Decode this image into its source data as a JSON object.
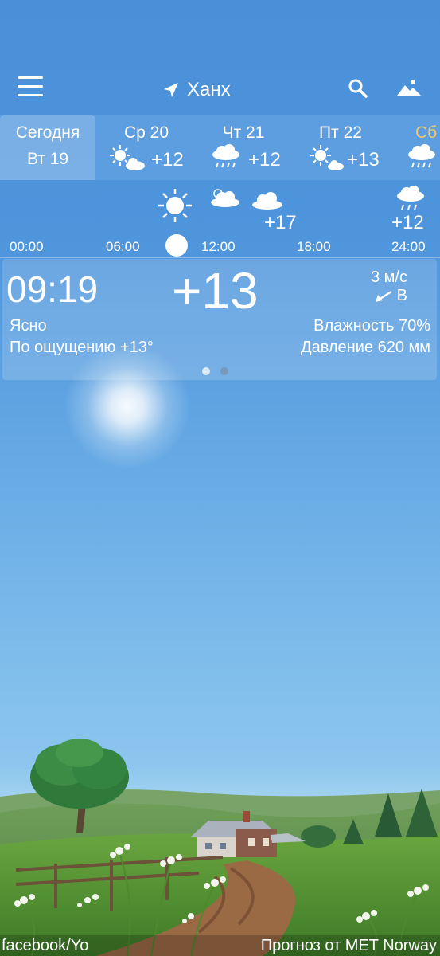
{
  "header": {
    "location_name": "Ханх"
  },
  "days": [
    {
      "name": "Сегодня",
      "date": "Вт 19",
      "selected": true
    },
    {
      "name": "Ср 20",
      "temp": "+12",
      "icon": "sun-cloud-icon"
    },
    {
      "name": "Чт 21",
      "temp": "+12",
      "icon": "rain-icon"
    },
    {
      "name": "Пт 22",
      "temp": "+13",
      "icon": "sun-cloud-icon"
    },
    {
      "name": "Сб",
      "icon": "rain-icon"
    }
  ],
  "timeline": {
    "labels": [
      "00:00",
      "06:00",
      "12:00",
      "18:00",
      "24:00"
    ],
    "temps": [
      "+17",
      "+12"
    ],
    "icons": [
      "sun-icon",
      "cloud-icon",
      "cloud-icon",
      "rain-icon"
    ]
  },
  "current": {
    "time_h": "09",
    "time_m": "19",
    "temp": "+13",
    "wind_speed": "3 м/с",
    "wind_dir": "В",
    "condition": "Ясно",
    "feels_like": "По ощущению +13°",
    "humidity": "Влажность 70%",
    "pressure": "Давление 620 мм",
    "page_count": 2,
    "active_page": 1
  },
  "footer": {
    "left_link": "facebook/Yo",
    "right_link": "Прогноз от MET Norway"
  },
  "colors": {
    "sky_top": "#4a90d9",
    "accent_weekend": "#f5c46e"
  }
}
